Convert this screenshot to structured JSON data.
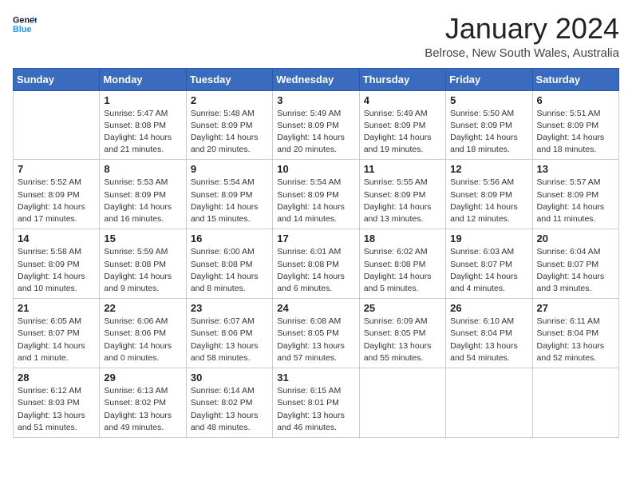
{
  "header": {
    "logo_line1": "General",
    "logo_line2": "Blue",
    "title": "January 2024",
    "subtitle": "Belrose, New South Wales, Australia"
  },
  "weekdays": [
    "Sunday",
    "Monday",
    "Tuesday",
    "Wednesday",
    "Thursday",
    "Friday",
    "Saturday"
  ],
  "weeks": [
    [
      {
        "day": "",
        "info": ""
      },
      {
        "day": "1",
        "info": "Sunrise: 5:47 AM\nSunset: 8:08 PM\nDaylight: 14 hours\nand 21 minutes."
      },
      {
        "day": "2",
        "info": "Sunrise: 5:48 AM\nSunset: 8:09 PM\nDaylight: 14 hours\nand 20 minutes."
      },
      {
        "day": "3",
        "info": "Sunrise: 5:49 AM\nSunset: 8:09 PM\nDaylight: 14 hours\nand 20 minutes."
      },
      {
        "day": "4",
        "info": "Sunrise: 5:49 AM\nSunset: 8:09 PM\nDaylight: 14 hours\nand 19 minutes."
      },
      {
        "day": "5",
        "info": "Sunrise: 5:50 AM\nSunset: 8:09 PM\nDaylight: 14 hours\nand 18 minutes."
      },
      {
        "day": "6",
        "info": "Sunrise: 5:51 AM\nSunset: 8:09 PM\nDaylight: 14 hours\nand 18 minutes."
      }
    ],
    [
      {
        "day": "7",
        "info": "Sunrise: 5:52 AM\nSunset: 8:09 PM\nDaylight: 14 hours\nand 17 minutes."
      },
      {
        "day": "8",
        "info": "Sunrise: 5:53 AM\nSunset: 8:09 PM\nDaylight: 14 hours\nand 16 minutes."
      },
      {
        "day": "9",
        "info": "Sunrise: 5:54 AM\nSunset: 8:09 PM\nDaylight: 14 hours\nand 15 minutes."
      },
      {
        "day": "10",
        "info": "Sunrise: 5:54 AM\nSunset: 8:09 PM\nDaylight: 14 hours\nand 14 minutes."
      },
      {
        "day": "11",
        "info": "Sunrise: 5:55 AM\nSunset: 8:09 PM\nDaylight: 14 hours\nand 13 minutes."
      },
      {
        "day": "12",
        "info": "Sunrise: 5:56 AM\nSunset: 8:09 PM\nDaylight: 14 hours\nand 12 minutes."
      },
      {
        "day": "13",
        "info": "Sunrise: 5:57 AM\nSunset: 8:09 PM\nDaylight: 14 hours\nand 11 minutes."
      }
    ],
    [
      {
        "day": "14",
        "info": "Sunrise: 5:58 AM\nSunset: 8:09 PM\nDaylight: 14 hours\nand 10 minutes."
      },
      {
        "day": "15",
        "info": "Sunrise: 5:59 AM\nSunset: 8:08 PM\nDaylight: 14 hours\nand 9 minutes."
      },
      {
        "day": "16",
        "info": "Sunrise: 6:00 AM\nSunset: 8:08 PM\nDaylight: 14 hours\nand 8 minutes."
      },
      {
        "day": "17",
        "info": "Sunrise: 6:01 AM\nSunset: 8:08 PM\nDaylight: 14 hours\nand 6 minutes."
      },
      {
        "day": "18",
        "info": "Sunrise: 6:02 AM\nSunset: 8:08 PM\nDaylight: 14 hours\nand 5 minutes."
      },
      {
        "day": "19",
        "info": "Sunrise: 6:03 AM\nSunset: 8:07 PM\nDaylight: 14 hours\nand 4 minutes."
      },
      {
        "day": "20",
        "info": "Sunrise: 6:04 AM\nSunset: 8:07 PM\nDaylight: 14 hours\nand 3 minutes."
      }
    ],
    [
      {
        "day": "21",
        "info": "Sunrise: 6:05 AM\nSunset: 8:07 PM\nDaylight: 14 hours\nand 1 minute."
      },
      {
        "day": "22",
        "info": "Sunrise: 6:06 AM\nSunset: 8:06 PM\nDaylight: 14 hours\nand 0 minutes."
      },
      {
        "day": "23",
        "info": "Sunrise: 6:07 AM\nSunset: 8:06 PM\nDaylight: 13 hours\nand 58 minutes."
      },
      {
        "day": "24",
        "info": "Sunrise: 6:08 AM\nSunset: 8:05 PM\nDaylight: 13 hours\nand 57 minutes."
      },
      {
        "day": "25",
        "info": "Sunrise: 6:09 AM\nSunset: 8:05 PM\nDaylight: 13 hours\nand 55 minutes."
      },
      {
        "day": "26",
        "info": "Sunrise: 6:10 AM\nSunset: 8:04 PM\nDaylight: 13 hours\nand 54 minutes."
      },
      {
        "day": "27",
        "info": "Sunrise: 6:11 AM\nSunset: 8:04 PM\nDaylight: 13 hours\nand 52 minutes."
      }
    ],
    [
      {
        "day": "28",
        "info": "Sunrise: 6:12 AM\nSunset: 8:03 PM\nDaylight: 13 hours\nand 51 minutes."
      },
      {
        "day": "29",
        "info": "Sunrise: 6:13 AM\nSunset: 8:02 PM\nDaylight: 13 hours\nand 49 minutes."
      },
      {
        "day": "30",
        "info": "Sunrise: 6:14 AM\nSunset: 8:02 PM\nDaylight: 13 hours\nand 48 minutes."
      },
      {
        "day": "31",
        "info": "Sunrise: 6:15 AM\nSunset: 8:01 PM\nDaylight: 13 hours\nand 46 minutes."
      },
      {
        "day": "",
        "info": ""
      },
      {
        "day": "",
        "info": ""
      },
      {
        "day": "",
        "info": ""
      }
    ]
  ]
}
